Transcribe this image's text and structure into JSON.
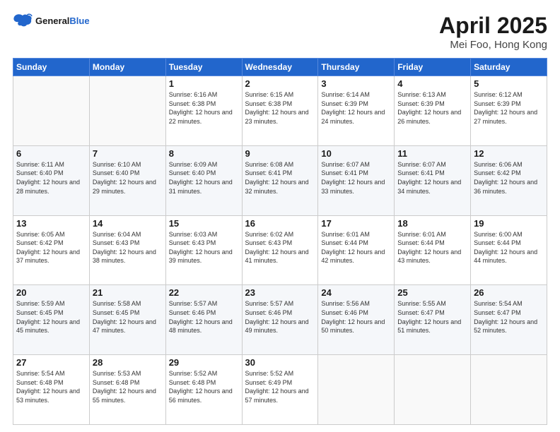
{
  "header": {
    "logo_line1": "General",
    "logo_line2": "Blue",
    "title": "April 2025",
    "subtitle": "Mei Foo, Hong Kong"
  },
  "days_of_week": [
    "Sunday",
    "Monday",
    "Tuesday",
    "Wednesday",
    "Thursday",
    "Friday",
    "Saturday"
  ],
  "weeks": [
    [
      {
        "day": "",
        "sunrise": "",
        "sunset": "",
        "daylight": ""
      },
      {
        "day": "",
        "sunrise": "",
        "sunset": "",
        "daylight": ""
      },
      {
        "day": "1",
        "sunrise": "Sunrise: 6:16 AM",
        "sunset": "Sunset: 6:38 PM",
        "daylight": "Daylight: 12 hours and 22 minutes."
      },
      {
        "day": "2",
        "sunrise": "Sunrise: 6:15 AM",
        "sunset": "Sunset: 6:38 PM",
        "daylight": "Daylight: 12 hours and 23 minutes."
      },
      {
        "day": "3",
        "sunrise": "Sunrise: 6:14 AM",
        "sunset": "Sunset: 6:39 PM",
        "daylight": "Daylight: 12 hours and 24 minutes."
      },
      {
        "day": "4",
        "sunrise": "Sunrise: 6:13 AM",
        "sunset": "Sunset: 6:39 PM",
        "daylight": "Daylight: 12 hours and 26 minutes."
      },
      {
        "day": "5",
        "sunrise": "Sunrise: 6:12 AM",
        "sunset": "Sunset: 6:39 PM",
        "daylight": "Daylight: 12 hours and 27 minutes."
      }
    ],
    [
      {
        "day": "6",
        "sunrise": "Sunrise: 6:11 AM",
        "sunset": "Sunset: 6:40 PM",
        "daylight": "Daylight: 12 hours and 28 minutes."
      },
      {
        "day": "7",
        "sunrise": "Sunrise: 6:10 AM",
        "sunset": "Sunset: 6:40 PM",
        "daylight": "Daylight: 12 hours and 29 minutes."
      },
      {
        "day": "8",
        "sunrise": "Sunrise: 6:09 AM",
        "sunset": "Sunset: 6:40 PM",
        "daylight": "Daylight: 12 hours and 31 minutes."
      },
      {
        "day": "9",
        "sunrise": "Sunrise: 6:08 AM",
        "sunset": "Sunset: 6:41 PM",
        "daylight": "Daylight: 12 hours and 32 minutes."
      },
      {
        "day": "10",
        "sunrise": "Sunrise: 6:07 AM",
        "sunset": "Sunset: 6:41 PM",
        "daylight": "Daylight: 12 hours and 33 minutes."
      },
      {
        "day": "11",
        "sunrise": "Sunrise: 6:07 AM",
        "sunset": "Sunset: 6:41 PM",
        "daylight": "Daylight: 12 hours and 34 minutes."
      },
      {
        "day": "12",
        "sunrise": "Sunrise: 6:06 AM",
        "sunset": "Sunset: 6:42 PM",
        "daylight": "Daylight: 12 hours and 36 minutes."
      }
    ],
    [
      {
        "day": "13",
        "sunrise": "Sunrise: 6:05 AM",
        "sunset": "Sunset: 6:42 PM",
        "daylight": "Daylight: 12 hours and 37 minutes."
      },
      {
        "day": "14",
        "sunrise": "Sunrise: 6:04 AM",
        "sunset": "Sunset: 6:43 PM",
        "daylight": "Daylight: 12 hours and 38 minutes."
      },
      {
        "day": "15",
        "sunrise": "Sunrise: 6:03 AM",
        "sunset": "Sunset: 6:43 PM",
        "daylight": "Daylight: 12 hours and 39 minutes."
      },
      {
        "day": "16",
        "sunrise": "Sunrise: 6:02 AM",
        "sunset": "Sunset: 6:43 PM",
        "daylight": "Daylight: 12 hours and 41 minutes."
      },
      {
        "day": "17",
        "sunrise": "Sunrise: 6:01 AM",
        "sunset": "Sunset: 6:44 PM",
        "daylight": "Daylight: 12 hours and 42 minutes."
      },
      {
        "day": "18",
        "sunrise": "Sunrise: 6:01 AM",
        "sunset": "Sunset: 6:44 PM",
        "daylight": "Daylight: 12 hours and 43 minutes."
      },
      {
        "day": "19",
        "sunrise": "Sunrise: 6:00 AM",
        "sunset": "Sunset: 6:44 PM",
        "daylight": "Daylight: 12 hours and 44 minutes."
      }
    ],
    [
      {
        "day": "20",
        "sunrise": "Sunrise: 5:59 AM",
        "sunset": "Sunset: 6:45 PM",
        "daylight": "Daylight: 12 hours and 45 minutes."
      },
      {
        "day": "21",
        "sunrise": "Sunrise: 5:58 AM",
        "sunset": "Sunset: 6:45 PM",
        "daylight": "Daylight: 12 hours and 47 minutes."
      },
      {
        "day": "22",
        "sunrise": "Sunrise: 5:57 AM",
        "sunset": "Sunset: 6:46 PM",
        "daylight": "Daylight: 12 hours and 48 minutes."
      },
      {
        "day": "23",
        "sunrise": "Sunrise: 5:57 AM",
        "sunset": "Sunset: 6:46 PM",
        "daylight": "Daylight: 12 hours and 49 minutes."
      },
      {
        "day": "24",
        "sunrise": "Sunrise: 5:56 AM",
        "sunset": "Sunset: 6:46 PM",
        "daylight": "Daylight: 12 hours and 50 minutes."
      },
      {
        "day": "25",
        "sunrise": "Sunrise: 5:55 AM",
        "sunset": "Sunset: 6:47 PM",
        "daylight": "Daylight: 12 hours and 51 minutes."
      },
      {
        "day": "26",
        "sunrise": "Sunrise: 5:54 AM",
        "sunset": "Sunset: 6:47 PM",
        "daylight": "Daylight: 12 hours and 52 minutes."
      }
    ],
    [
      {
        "day": "27",
        "sunrise": "Sunrise: 5:54 AM",
        "sunset": "Sunset: 6:48 PM",
        "daylight": "Daylight: 12 hours and 53 minutes."
      },
      {
        "day": "28",
        "sunrise": "Sunrise: 5:53 AM",
        "sunset": "Sunset: 6:48 PM",
        "daylight": "Daylight: 12 hours and 55 minutes."
      },
      {
        "day": "29",
        "sunrise": "Sunrise: 5:52 AM",
        "sunset": "Sunset: 6:48 PM",
        "daylight": "Daylight: 12 hours and 56 minutes."
      },
      {
        "day": "30",
        "sunrise": "Sunrise: 5:52 AM",
        "sunset": "Sunset: 6:49 PM",
        "daylight": "Daylight: 12 hours and 57 minutes."
      },
      {
        "day": "",
        "sunrise": "",
        "sunset": "",
        "daylight": ""
      },
      {
        "day": "",
        "sunrise": "",
        "sunset": "",
        "daylight": ""
      },
      {
        "day": "",
        "sunrise": "",
        "sunset": "",
        "daylight": ""
      }
    ]
  ]
}
